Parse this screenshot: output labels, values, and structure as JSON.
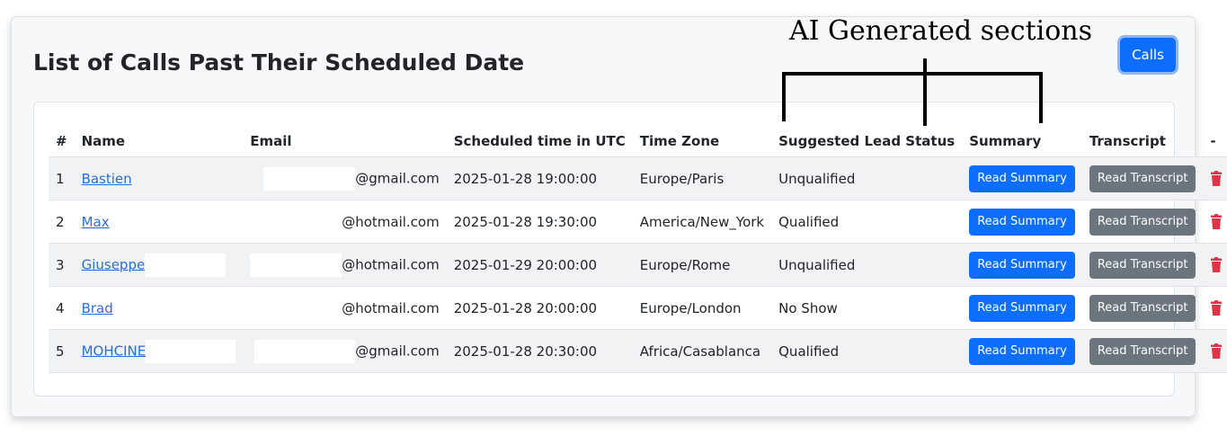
{
  "annotation": {
    "text": "AI Generated sections"
  },
  "header": {
    "title": "List of Calls Past Their Scheduled Date",
    "calls_button": "Calls"
  },
  "table": {
    "columns": [
      "#",
      "Name",
      "Email",
      "Scheduled time in UTC",
      "Time Zone",
      "Suggested Lead Status",
      "Summary",
      "Transcript",
      "-"
    ],
    "rows": [
      {
        "num": "1",
        "name": "Bastien",
        "email": "@gmail.com",
        "time": "2025-01-28 19:00:00",
        "tz": "Europe/Paris",
        "status": "Unqualified"
      },
      {
        "num": "2",
        "name": "Max",
        "email": "@hotmail.com",
        "time": "2025-01-28 19:30:00",
        "tz": "America/New_York",
        "status": "Qualified"
      },
      {
        "num": "3",
        "name": "Giuseppe",
        "email": "@hotmail.com",
        "time": "2025-01-29 20:00:00",
        "tz": "Europe/Rome",
        "status": "Unqualified"
      },
      {
        "num": "4",
        "name": "Brad",
        "email": "@hotmail.com",
        "time": "2025-01-28 20:00:00",
        "tz": "Europe/London",
        "status": "No Show"
      },
      {
        "num": "5",
        "name": "MOHCINE",
        "email": "@gmail.com",
        "time": "2025-01-28 20:30:00",
        "tz": "Africa/Casablanca",
        "status": "Qualified"
      }
    ],
    "summary_button": "Read Summary",
    "transcript_button": "Read Transcript"
  },
  "colors": {
    "primary": "#0d6efd",
    "secondary": "#6c757d",
    "danger": "#dc3545",
    "link": "#2b6ed6"
  },
  "icons": {
    "delete": "trash-icon"
  }
}
